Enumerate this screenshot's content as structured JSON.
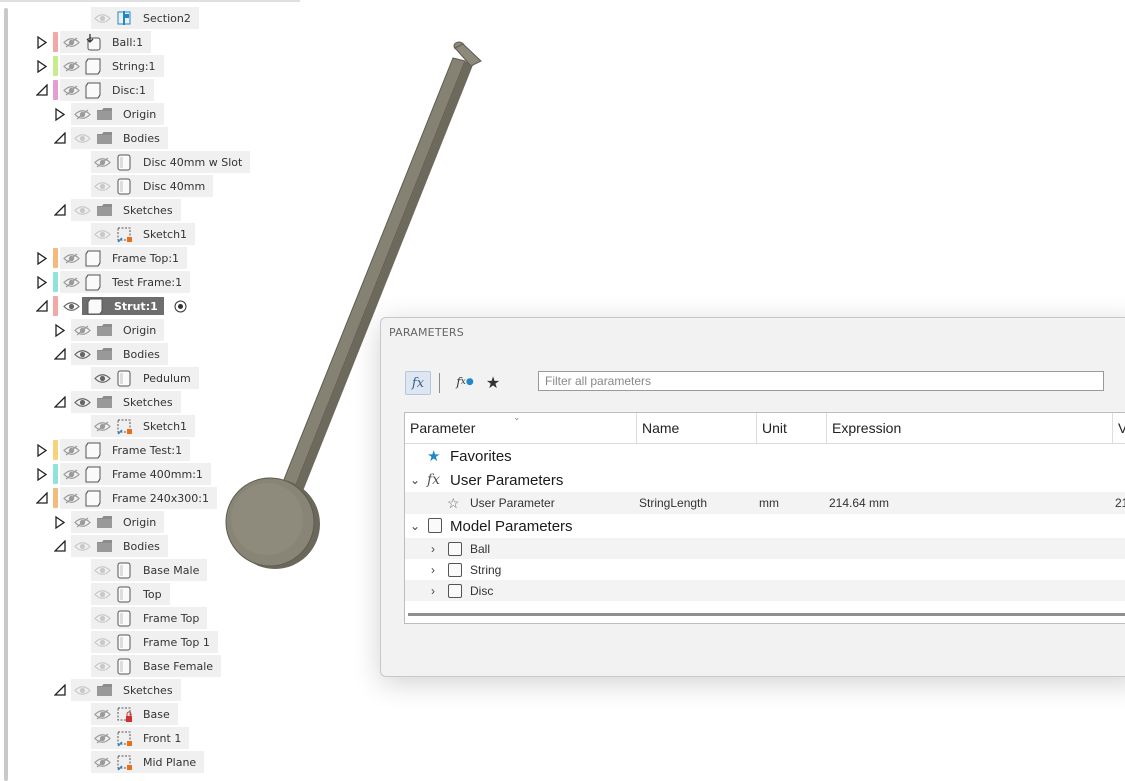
{
  "browser": {
    "rows": [
      {
        "label": "Section2",
        "indent": 2,
        "exp": "none",
        "color": null,
        "eye": "on",
        "icon": "section-icon"
      },
      {
        "label": "Ball:1",
        "indent": 0,
        "exp": "collapsed",
        "color": "#f4a7a7",
        "eye": "off",
        "icon": "joint-component-icon"
      },
      {
        "label": "String:1",
        "indent": 0,
        "exp": "collapsed",
        "color": "#c7ec8a",
        "eye": "off",
        "icon": "component-icon"
      },
      {
        "label": "Disc:1",
        "indent": 0,
        "exp": "expanded",
        "color": "#e69bd3",
        "eye": "off",
        "icon": "component-icon"
      },
      {
        "label": "Origin",
        "indent": 1,
        "exp": "collapsed",
        "color": null,
        "eye": "off",
        "icon": "folder-icon"
      },
      {
        "label": "Bodies",
        "indent": 1,
        "exp": "expanded",
        "color": null,
        "eye": "on",
        "icon": "folder-icon"
      },
      {
        "label": "Disc 40mm w Slot",
        "indent": 2,
        "exp": "none",
        "color": null,
        "eye": "off",
        "icon": "body-icon"
      },
      {
        "label": "Disc 40mm",
        "indent": 2,
        "exp": "none",
        "color": null,
        "eye": "on",
        "icon": "body-icon"
      },
      {
        "label": "Sketches",
        "indent": 1,
        "exp": "expanded",
        "color": null,
        "eye": "on",
        "icon": "folder-icon"
      },
      {
        "label": "Sketch1",
        "indent": 2,
        "exp": "none",
        "color": null,
        "eye": "on",
        "icon": "sketch-icon"
      },
      {
        "label": "Frame Top:1",
        "indent": 0,
        "exp": "collapsed",
        "color": "#f5b97a",
        "eye": "off",
        "icon": "component-icon"
      },
      {
        "label": "Test Frame:1",
        "indent": 0,
        "exp": "collapsed",
        "color": "#8ee3dc",
        "eye": "off",
        "icon": "component-icon"
      },
      {
        "label": "Strut:1",
        "indent": 0,
        "exp": "expanded",
        "color": "#f4a7a7",
        "eye": "on-dark",
        "icon": "component-icon",
        "selected": true
      },
      {
        "label": "Origin",
        "indent": 1,
        "exp": "collapsed",
        "color": null,
        "eye": "off",
        "icon": "folder-icon"
      },
      {
        "label": "Bodies",
        "indent": 1,
        "exp": "expanded",
        "color": null,
        "eye": "on-dark",
        "icon": "folder-icon"
      },
      {
        "label": "Pedulum",
        "indent": 2,
        "exp": "none",
        "color": null,
        "eye": "on-dark",
        "icon": "body-icon"
      },
      {
        "label": "Sketches",
        "indent": 1,
        "exp": "expanded",
        "color": null,
        "eye": "on-dark",
        "icon": "folder-icon"
      },
      {
        "label": "Sketch1",
        "indent": 2,
        "exp": "none",
        "color": null,
        "eye": "off",
        "icon": "sketch-icon"
      },
      {
        "label": "Frame Test:1",
        "indent": 0,
        "exp": "collapsed",
        "color": "#f7d27a",
        "eye": "off",
        "icon": "component-icon"
      },
      {
        "label": "Frame 400mm:1",
        "indent": 0,
        "exp": "collapsed",
        "color": "#8ee3dc",
        "eye": "off",
        "icon": "component-icon"
      },
      {
        "label": "Frame 240x300:1",
        "indent": 0,
        "exp": "expanded",
        "color": "#f5b97a",
        "eye": "off",
        "icon": "component-icon"
      },
      {
        "label": "Origin",
        "indent": 1,
        "exp": "collapsed",
        "color": null,
        "eye": "off",
        "icon": "folder-icon"
      },
      {
        "label": "Bodies",
        "indent": 1,
        "exp": "expanded",
        "color": null,
        "eye": "on",
        "icon": "folder-icon"
      },
      {
        "label": "Base Male",
        "indent": 2,
        "exp": "none",
        "color": null,
        "eye": "on",
        "icon": "body-icon"
      },
      {
        "label": "Top",
        "indent": 2,
        "exp": "none",
        "color": null,
        "eye": "on",
        "icon": "body-icon"
      },
      {
        "label": "Frame Top",
        "indent": 2,
        "exp": "none",
        "color": null,
        "eye": "on",
        "icon": "body-icon"
      },
      {
        "label": "Frame Top 1",
        "indent": 2,
        "exp": "none",
        "color": null,
        "eye": "on",
        "icon": "body-icon"
      },
      {
        "label": "Base Female",
        "indent": 2,
        "exp": "none",
        "color": null,
        "eye": "on",
        "icon": "body-icon"
      },
      {
        "label": "Sketches",
        "indent": 1,
        "exp": "expanded",
        "color": null,
        "eye": "on",
        "icon": "folder-icon"
      },
      {
        "label": "Base",
        "indent": 2,
        "exp": "none",
        "color": null,
        "eye": "off",
        "icon": "sketch-locked-icon"
      },
      {
        "label": "Front 1",
        "indent": 2,
        "exp": "none",
        "color": null,
        "eye": "off",
        "icon": "sketch-icon"
      },
      {
        "label": "Mid Plane",
        "indent": 2,
        "exp": "none",
        "color": null,
        "eye": "off",
        "icon": "sketch-icon"
      }
    ]
  },
  "parameters": {
    "title": "PARAMETERS",
    "filter_placeholder": "Filter all parameters",
    "columns": [
      "Parameter",
      "Name",
      "Unit",
      "Expression",
      "V"
    ],
    "favorites_label": "Favorites",
    "user_parameters_label": "User Parameters",
    "user_param": {
      "label": "User Parameter",
      "name": "StringLength",
      "unit": "mm",
      "expression": "214.64 mm",
      "value": "21"
    },
    "model_parameters_label": "Model Parameters",
    "models": [
      "Ball",
      "String",
      "Disc"
    ]
  },
  "colors": {
    "model_body": "#858273",
    "model_edge": "#5e5b50",
    "accent": "#1e88c9"
  }
}
